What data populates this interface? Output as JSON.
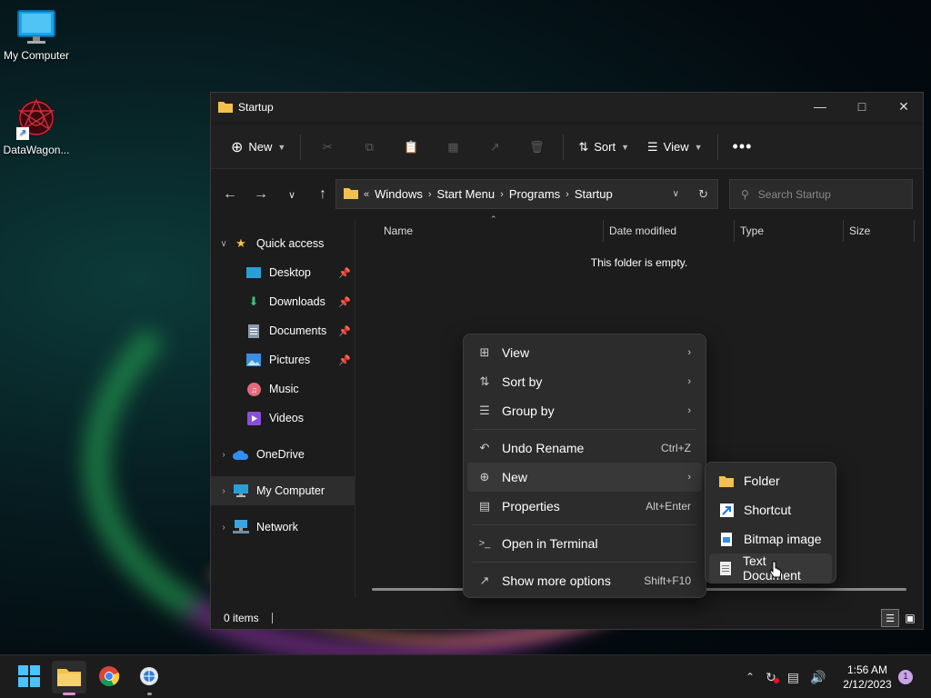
{
  "desktop": {
    "icons": [
      {
        "label": "My Computer"
      },
      {
        "label": "DataWagon..."
      }
    ]
  },
  "window": {
    "title": "Startup",
    "toolbar": {
      "new_label": "New",
      "sort_label": "Sort",
      "view_label": "View"
    },
    "breadcrumb": [
      "Windows",
      "Start Menu",
      "Programs",
      "Startup"
    ],
    "search_placeholder": "Search Startup",
    "nav": {
      "quick_access": "Quick access",
      "items": [
        {
          "label": "Desktop",
          "pinned": true
        },
        {
          "label": "Downloads",
          "pinned": true
        },
        {
          "label": "Documents",
          "pinned": true
        },
        {
          "label": "Pictures",
          "pinned": true
        },
        {
          "label": "Music",
          "pinned": false
        },
        {
          "label": "Videos",
          "pinned": false
        }
      ],
      "onedrive": "OneDrive",
      "my_computer": "My Computer",
      "network": "Network"
    },
    "columns": [
      "Name",
      "Date modified",
      "Type",
      "Size"
    ],
    "empty_message": "This folder is empty.",
    "status": "0 items"
  },
  "context_menu": {
    "items": [
      {
        "label": "View",
        "icon": "grid-icon",
        "submenu": true
      },
      {
        "label": "Sort by",
        "icon": "sort-icon",
        "submenu": true
      },
      {
        "label": "Group by",
        "icon": "group-icon",
        "submenu": true
      },
      {
        "label": "Undo Rename",
        "icon": "undo-icon",
        "shortcut": "Ctrl+Z"
      },
      {
        "label": "New",
        "icon": "new-icon",
        "submenu": true
      },
      {
        "label": "Properties",
        "icon": "properties-icon",
        "shortcut": "Alt+Enter"
      },
      {
        "label": "Open in Terminal",
        "icon": "terminal-icon"
      },
      {
        "label": "Show more options",
        "icon": "more-options-icon",
        "shortcut": "Shift+F10"
      }
    ]
  },
  "new_submenu": {
    "items": [
      {
        "label": "Folder",
        "icon": "folder-icon"
      },
      {
        "label": "Shortcut",
        "icon": "shortcut-icon"
      },
      {
        "label": "Bitmap image",
        "icon": "bitmap-icon"
      },
      {
        "label": "Text Document",
        "icon": "text-document-icon"
      }
    ]
  },
  "taskbar": {
    "time": "1:56 AM",
    "date": "2/12/2023",
    "notification_count": "1"
  },
  "colors": {
    "accent": "#0078d4",
    "folder": "#f2c14e",
    "window_bg": "#1c1c1c"
  }
}
